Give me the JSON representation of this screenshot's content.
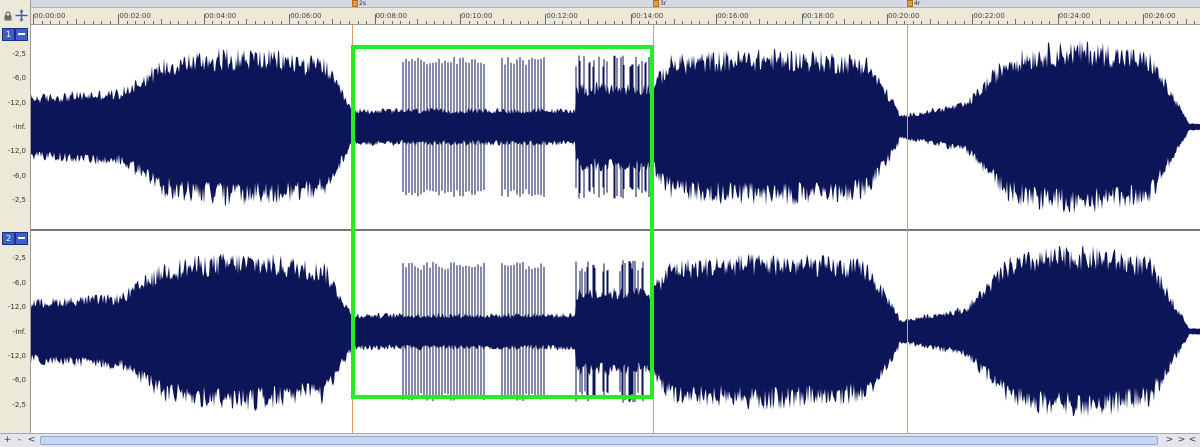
{
  "colors": {
    "waveform": "#0b1557",
    "selection": "#22ee22",
    "marker_line": "#d9a066",
    "divider": "#4a4a4a",
    "background": "#ffffff"
  },
  "icons": {
    "lock": "lock-icon",
    "zoom": "zoom-icon"
  },
  "tracks": [
    {
      "label": "1",
      "db_labels": [
        "-2,5",
        "-6,0",
        "-12,0",
        "-Inf.",
        "-12,0",
        "-6,0",
        "-2,5"
      ]
    },
    {
      "label": "2",
      "db_labels": [
        "-2,5",
        "-6,0",
        "-12,0",
        "-Inf.",
        "-12,0",
        "-6,0",
        "-2,5"
      ]
    }
  ],
  "timeline": {
    "labels": [
      "00:00:00",
      "00:02:00",
      "00:04:00",
      "00:06:00",
      "00:08:00",
      "00:10:00",
      "00:12:00",
      "00:14:00",
      "00:16:00",
      "00:18:00",
      "00:20:00",
      "00:22:00",
      "00:24:00",
      "00:26:00"
    ],
    "markers": [
      {
        "label": "2s",
        "position": 0.2746
      },
      {
        "label": "3r",
        "position": 0.5321
      },
      {
        "label": "4r",
        "position": 0.7497
      }
    ]
  },
  "scrollbar": {
    "zoom_out": "+",
    "zoom_in": "-",
    "scroll_left": "<",
    "scroll_right": ">"
  }
}
